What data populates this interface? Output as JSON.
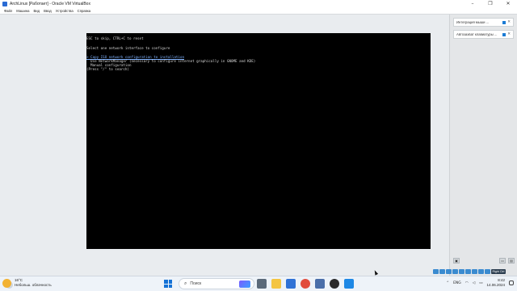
{
  "window": {
    "title": "ArchLinux [Работает] - Oracle VM VirtualBox",
    "controls": [
      "–",
      "❐",
      "✕"
    ]
  },
  "menu": [
    "Файл",
    "Машина",
    "Вид",
    "Ввод",
    "Устройства",
    "Справка"
  ],
  "console": {
    "lines": [
      "ESC to skip, CTRL+C to reset",
      "Select one network interface to configure",
      "> Copy ISO network configuration to installation",
      "  Use NetworkManager (necessary to configure internet graphically in GNOME and KDE)",
      "  Manual configuration",
      "(Press \"/\" to search)"
    ]
  },
  "notifications": [
    {
      "text": "Интеграция мыши ...",
      "icon": "info-icon"
    },
    {
      "text": "Автозахват клавиатуры ...",
      "icon": "info-icon"
    }
  ],
  "statusbar": {
    "host_key": "Right Ctrl"
  },
  "taskbar": {
    "weather_temp": "16°C",
    "weather_desc": "Небольш. облачность",
    "search_label": "Поиск",
    "language": "ENG",
    "time": "8:42",
    "date": "14.06.2024"
  },
  "colors": {
    "console_bg": "#000000",
    "console_text": "#d6d6d6",
    "selected_text": "#7fb2ff",
    "accent": "#1572d6"
  }
}
